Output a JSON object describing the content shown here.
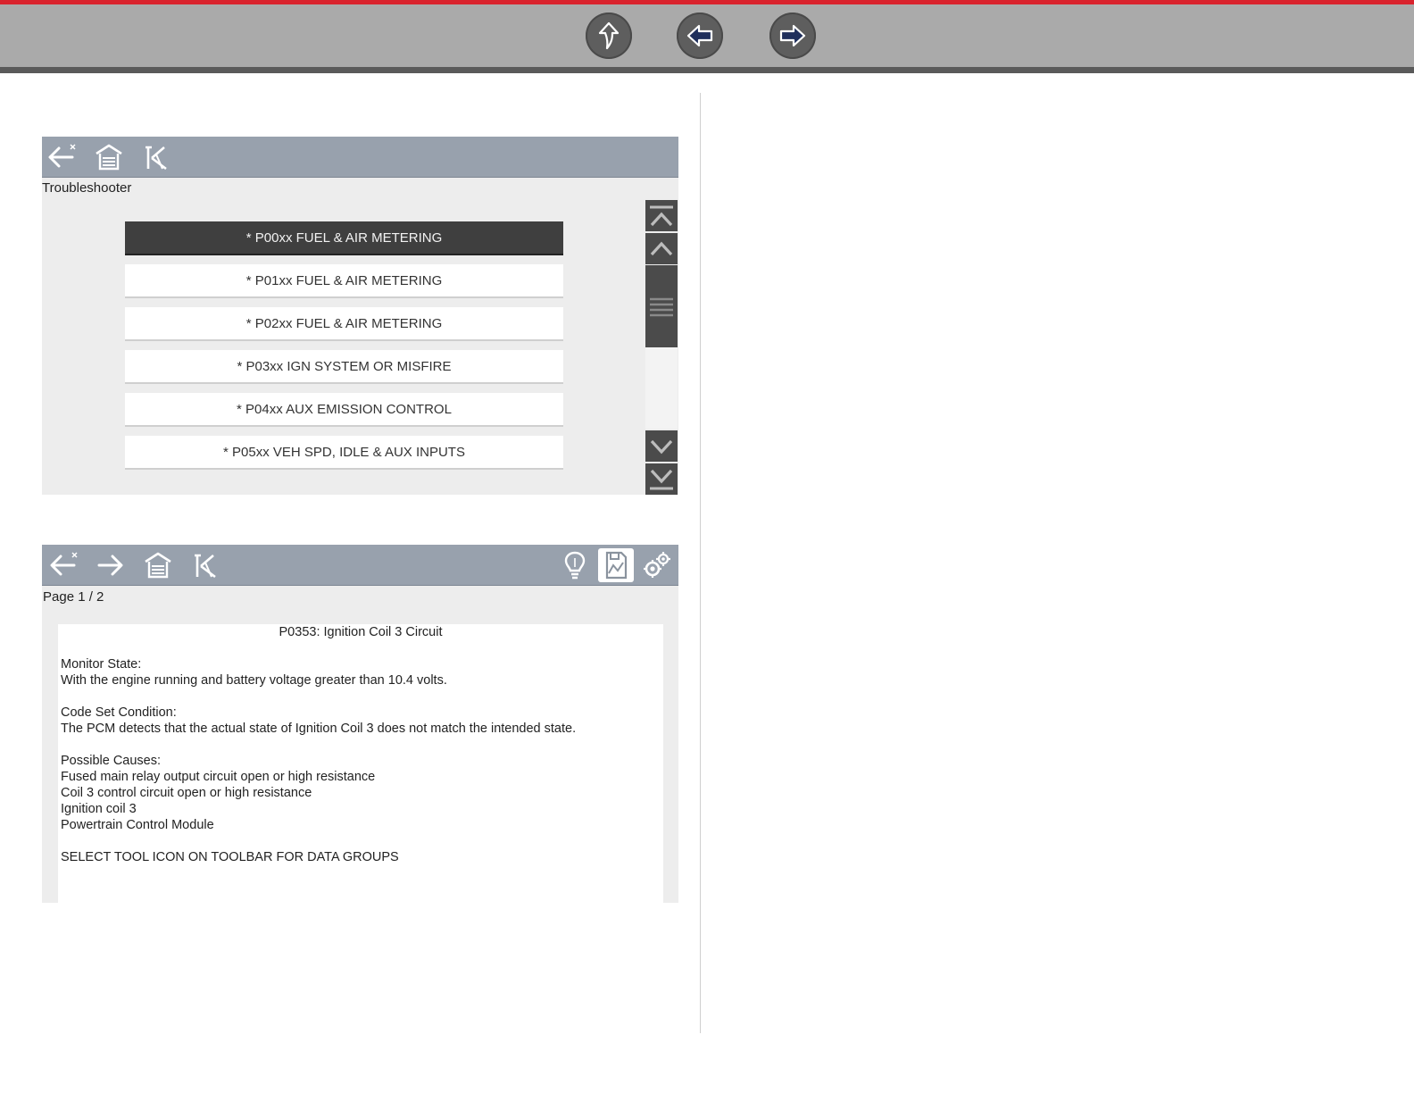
{
  "top_nav": {
    "buttons": [
      {
        "name": "up-button",
        "icon": "curved-up-arrow-icon"
      },
      {
        "name": "previous-button",
        "icon": "left-arrow-icon"
      },
      {
        "name": "next-button",
        "icon": "right-arrow-icon"
      }
    ],
    "colors": {
      "accent_line": "#d9232d",
      "bar": "#aaaaaa"
    }
  },
  "troubleshooter": {
    "toolbar_icons": [
      "back-icon",
      "home-icon",
      "exit-icon"
    ],
    "title": "Troubleshooter",
    "items": [
      {
        "label": "* P00xx FUEL & AIR METERING",
        "selected": true
      },
      {
        "label": "* P01xx FUEL & AIR METERING",
        "selected": false
      },
      {
        "label": "* P02xx FUEL & AIR METERING",
        "selected": false
      },
      {
        "label": "* P03xx IGN SYSTEM OR MISFIRE",
        "selected": false
      },
      {
        "label": "* P04xx AUX EMISSION CONTROL",
        "selected": false
      },
      {
        "label": "* P05xx VEH SPD, IDLE & AUX INPUTS",
        "selected": false
      }
    ],
    "scrollbar_icons": [
      "scroll-top-icon",
      "scroll-up-icon",
      "scroll-down-icon",
      "scroll-bottom-icon"
    ]
  },
  "code_info": {
    "toolbar_icons": [
      "back-icon",
      "forward-icon",
      "home-icon",
      "exit-icon",
      "lightbulb-icon",
      "save-report-icon",
      "tools-icon"
    ],
    "page_label": "Page 1 / 2",
    "title": "P0353: Ignition Coil 3 Circuit",
    "lines": [
      "Monitor State:",
      "With the engine running and battery voltage greater than 10.4 volts.",
      "Code Set Condition:",
      "The PCM detects that the actual state of Ignition Coil 3 does not match the intended state.",
      "Possible Causes:",
      "Fused main relay output circuit open or high resistance",
      "Coil 3 control circuit open or high resistance",
      "Ignition coil 3",
      "Powertrain Control Module",
      "SELECT TOOL ICON ON TOOLBAR FOR DATA GROUPS"
    ]
  }
}
